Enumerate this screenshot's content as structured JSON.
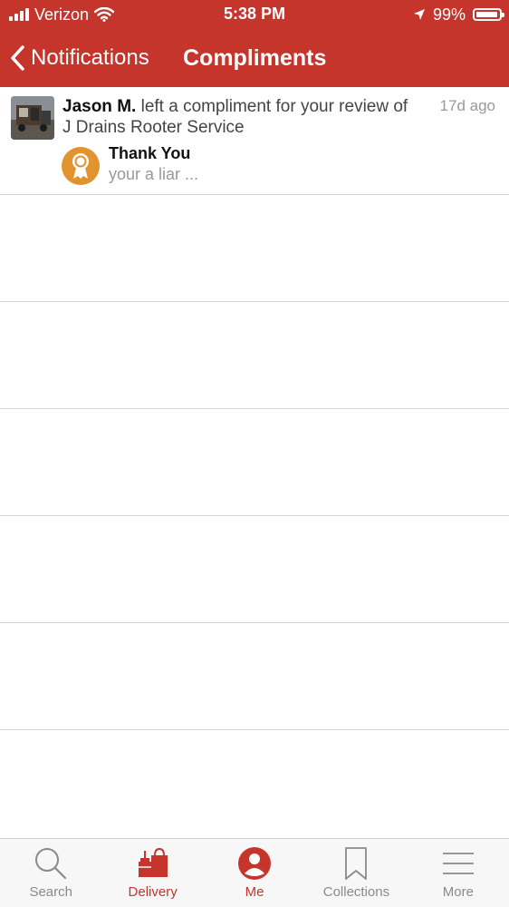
{
  "status_bar": {
    "carrier": "Verizon",
    "time": "5:38 PM",
    "battery": "99%"
  },
  "nav": {
    "back_label": "Notifications",
    "title": "Compliments"
  },
  "notification": {
    "user": "Jason M.",
    "action_text": "left a compliment for your review of",
    "business": "J Drains Rooter Service",
    "time_ago": "17d ago",
    "compliment_title": "Thank You",
    "compliment_message": "your a liar ..."
  },
  "tabs": [
    {
      "label": "Search",
      "icon": "search-icon"
    },
    {
      "label": "Delivery",
      "icon": "delivery-bag-icon"
    },
    {
      "label": "Me",
      "icon": "profile-icon"
    },
    {
      "label": "Collections",
      "icon": "bookmark-icon"
    },
    {
      "label": "More",
      "icon": "menu-icon"
    }
  ],
  "colors": {
    "brand_red": "#c6352c",
    "badge_orange": "#e2922f"
  }
}
